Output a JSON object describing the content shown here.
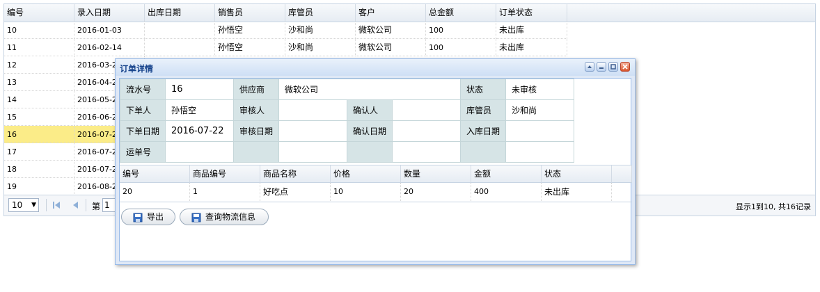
{
  "grid": {
    "columns": [
      "编号",
      "录入日期",
      "出库日期",
      "销售员",
      "库管员",
      "客户",
      "总金额",
      "订单状态"
    ],
    "rows": [
      {
        "id": "10",
        "entry_date": "2016-01-03",
        "out_date": "",
        "salesperson": "孙悟空",
        "keeper": "沙和尚",
        "customer": "微软公司",
        "total": "100",
        "status": "未出库"
      },
      {
        "id": "11",
        "entry_date": "2016-02-14",
        "out_date": "",
        "salesperson": "孙悟空",
        "keeper": "沙和尚",
        "customer": "微软公司",
        "total": "100",
        "status": "未出库"
      },
      {
        "id": "12",
        "entry_date": "2016-03-2"
      },
      {
        "id": "13",
        "entry_date": "2016-04-2"
      },
      {
        "id": "14",
        "entry_date": "2016-05-2"
      },
      {
        "id": "15",
        "entry_date": "2016-06-2"
      },
      {
        "id": "16",
        "entry_date": "2016-07-2"
      },
      {
        "id": "17",
        "entry_date": "2016-07-2"
      },
      {
        "id": "18",
        "entry_date": "2016-07-2"
      },
      {
        "id": "19",
        "entry_date": "2016-08-2"
      }
    ],
    "selected_row_id": "16"
  },
  "pager": {
    "page_size": "10",
    "page_label": "第",
    "page_value": "1",
    "info": "显示1到10, 共16记录"
  },
  "dialog": {
    "title": "订单详情",
    "form": {
      "serial_label": "流水号",
      "serial_value": "16",
      "supplier_label": "供应商",
      "supplier_value": "微软公司",
      "status_label": "状态",
      "status_value": "未审核",
      "orderer_label": "下单人",
      "orderer_value": "孙悟空",
      "reviewer_label": "审核人",
      "reviewer_value": "",
      "confirmer_label": "确认人",
      "confirmer_value": "",
      "keeper_label": "库管员",
      "keeper_value": "沙和尚",
      "order_date_label": "下单日期",
      "order_date_value": "2016-07-22",
      "review_date_label": "审核日期",
      "review_date_value": "",
      "confirm_date_label": "确认日期",
      "confirm_date_value": "",
      "in_date_label": "入库日期",
      "in_date_value": "",
      "waybill_label": "运单号",
      "waybill_value": ""
    },
    "items": {
      "columns": [
        "编号",
        "商品编号",
        "商品名称",
        "价格",
        "数量",
        "金额",
        "状态"
      ],
      "rows": [
        {
          "id": "20",
          "product_no": "1",
          "product_name": "好吃点",
          "price": "10",
          "quantity": "20",
          "amount": "400",
          "status": "未出库"
        }
      ]
    },
    "buttons": {
      "export_label": "导出",
      "logistics_label": "查询物流信息"
    }
  },
  "colors": {
    "selected_row": "#fbec88",
    "label_cell": "#d6e4e6",
    "window_border": "#99bbe8",
    "title_text": "#15428b"
  },
  "icons": [
    "collapse-icon",
    "minimize-icon",
    "maximize-icon",
    "close-icon",
    "first-page-icon",
    "prev-page-icon",
    "save-icon"
  ]
}
